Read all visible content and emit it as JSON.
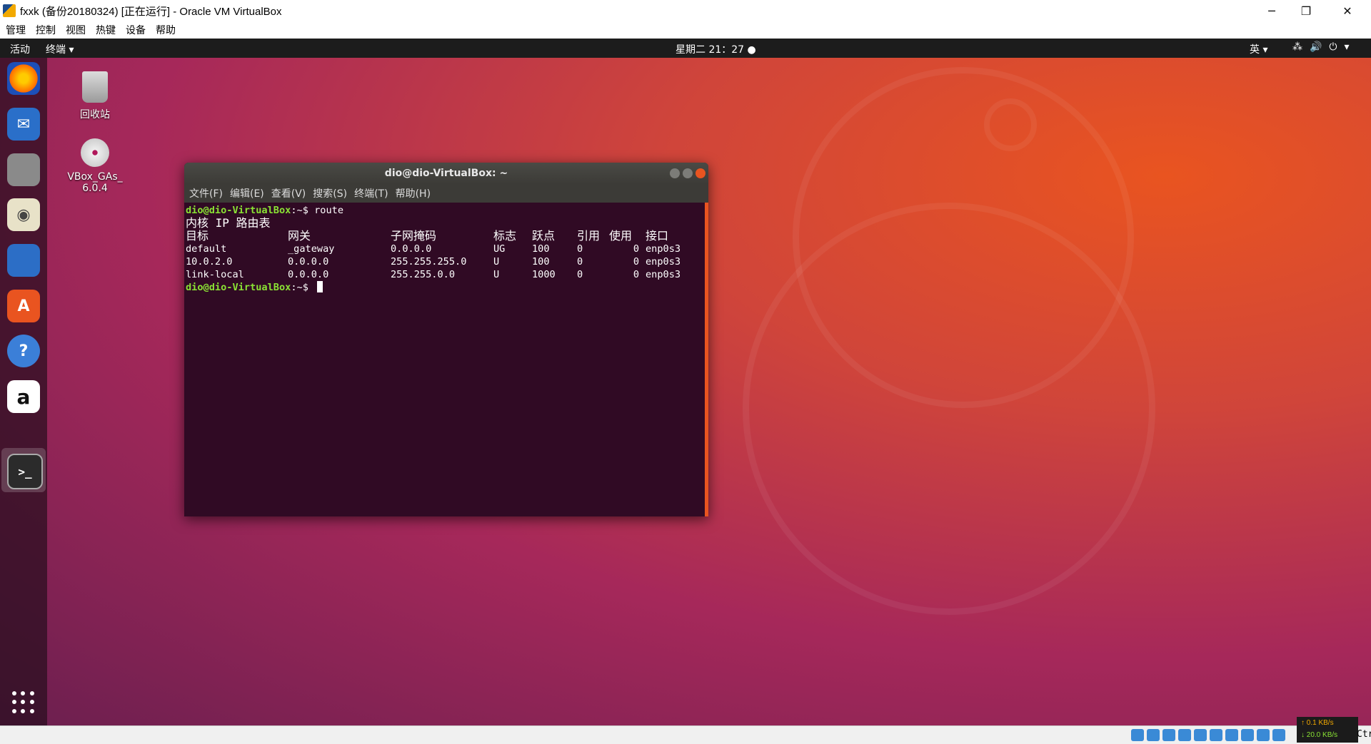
{
  "host": {
    "title": "fxxk (备份20180324) [正在运行] - Oracle VM VirtualBox",
    "controls": {
      "minimize": "─",
      "restore": "❐",
      "close": "✕"
    },
    "menu": [
      "管理",
      "控制",
      "视图",
      "热键",
      "设备",
      "帮助"
    ]
  },
  "guest": {
    "topbar": {
      "activities": "活动",
      "app_menu": "终端 ▾",
      "clock": "星期二 21：27 ●",
      "ime": "英 ▾",
      "system_icons": "⁂🔊⏻▾"
    },
    "dock": {
      "items": [
        {
          "name": "firefox",
          "glyph": "🦊"
        },
        {
          "name": "thunderbird",
          "glyph": "✉"
        },
        {
          "name": "files",
          "glyph": "🗄"
        },
        {
          "name": "rhythmbox",
          "glyph": "◉"
        },
        {
          "name": "libreoffice-writer",
          "glyph": "📄"
        },
        {
          "name": "software",
          "glyph": "A"
        },
        {
          "name": "help",
          "glyph": "?"
        },
        {
          "name": "amazon",
          "glyph": "a"
        },
        {
          "name": "terminal",
          "glyph": ">_"
        }
      ]
    },
    "desktop": {
      "trash_label": "回收站",
      "disc_label": "VBox_GAs_\n6.0.4"
    },
    "terminal": {
      "title": "dio@dio-VirtualBox: ~",
      "menu": [
        "文件(F)",
        "编辑(E)",
        "查看(V)",
        "搜索(S)",
        "终端(T)",
        "帮助(H)"
      ],
      "prompt": "dio@dio-VirtualBox",
      "prompt_suffix": ":~$ ",
      "command": "route",
      "heading": "内核 IP 路由表",
      "columns": [
        "目标",
        "网关",
        "子网掩码",
        "标志",
        "跃点",
        "引用",
        "使用",
        "接口"
      ],
      "rows": [
        [
          "default",
          "_gateway",
          "0.0.0.0",
          "UG",
          "100",
          "0",
          "0",
          "enp0s3"
        ],
        [
          "10.0.2.0",
          "0.0.0.0",
          "255.255.255.0",
          "U",
          "100",
          "0",
          "0",
          "enp0s3"
        ],
        [
          "link-local",
          "0.0.0.0",
          "255.255.0.0",
          "U",
          "1000",
          "0",
          "0",
          "enp0s3"
        ]
      ]
    }
  },
  "statusbar": {
    "net_up": "↑ 0.1 KB/s",
    "net_down": "↓ 20.0 KB/s",
    "host_key": "Ctrl"
  }
}
